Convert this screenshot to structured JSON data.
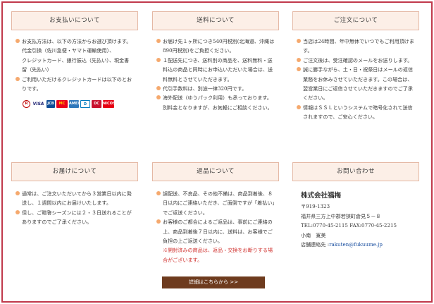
{
  "payment": {
    "title": "お支払いについて",
    "items": [
      "お支払方法は、以下の方法からお選び頂けます。",
      "ご利用いただけるクレジットカードは以下のとおりです。"
    ],
    "methods": [
      "代金引換（佐川急便・ヤマト運輸使用）、",
      "クレジットカード、銀行振込（先払い）、現金書留（先払い）"
    ],
    "cards": [
      "R",
      "VISA",
      "JCB",
      "MC",
      "AMEX",
      "D",
      "DC",
      "NICOS"
    ]
  },
  "shipping": {
    "title": "送料について",
    "items": [
      "お届け先１ヶ所につき540円税別(北海道、沖縄は890円税別)をご負担ください。",
      "１配送先につき、送料別の商品を、送料無料・送料込の商品と同時にお申込いただいた場合は、送料無料とさせていただきます。",
      "代引手数料は、別途一律320円です。",
      "海外配送（ゆうパック利用）も承っております。別料金となりますが、お気軽にご相談ください。"
    ]
  },
  "order": {
    "title": "ご注文について",
    "items": [
      "当店は24時間、年中無休でいつでもご利用頂けます。",
      "ご注文後は、受注確認のメールをお送りします。",
      "誠に勝手ながら、土・日・祝祭日はメールの返信業務をお休みさせていただきます。この場合は、翌営業日にご返信させていただきますのでご了承ください。",
      "情報はＳＳＬというシステムで暗号化されて送信されますので、ご安心ください。"
    ]
  },
  "delivery": {
    "title": "お届けについて",
    "items": [
      "通常は、ご注文いただいてから３営業日以内に発送し、１週間以内にお届けいたします。",
      "但し、ご贈答シーズンには２・３日送れることがありますのでご了承ください。"
    ]
  },
  "returns": {
    "title": "返品について",
    "items": [
      "誤配送、不良品、その他不備は、商品到着後、８日以内にご連絡いただき、ご面倒ですが「着払い」でご返送ください。",
      "お客様のご都合によるご返品は、事前にご連絡の上、商品到着後７日以内に、送料は、お客様でご負担の上ご返送ください。"
    ],
    "note": "※開封済みの商品は、返品・交換をお断りする場合がございます。"
  },
  "contact": {
    "title": "お問い合わせ",
    "company": "株式会社福梅",
    "zip": "〒919-1323",
    "address": "福井県三方上中郡若狭町倉見５－８",
    "tel": "TEL:0770-45-2115 FAX:0770-45-2215",
    "person": "小南　寛美",
    "email_label": "店舗連絡先 :",
    "email": "rakuten@fukuume.jp"
  },
  "details_button": "詳細はこちらから >>",
  "colors": {
    "frame": "#c0394b",
    "header_bg": "#fcefe7",
    "bullet": "#f5a96e",
    "button": "#6e3b1e",
    "note": "#d0302d"
  }
}
